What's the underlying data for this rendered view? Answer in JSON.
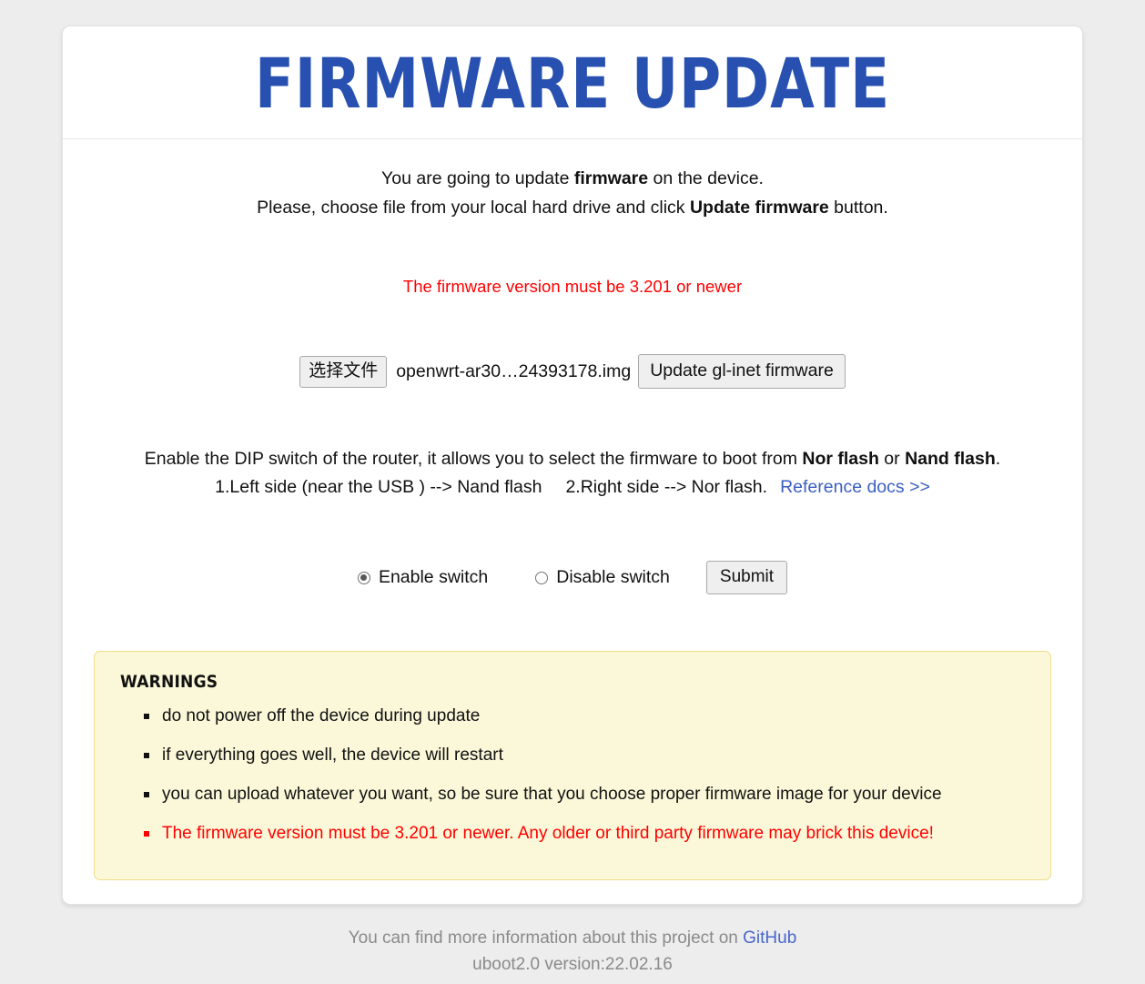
{
  "header": {
    "title": "FIRMWARE UPDATE"
  },
  "intro": {
    "line1_part1": "You are going to update ",
    "line1_bold": "firmware",
    "line1_part2": " on the device.",
    "line2_part1": "Please, choose file from your local hard drive and click ",
    "line2_bold": "Update firmware",
    "line2_part2": " button."
  },
  "notice": {
    "red_note": "The firmware version must be 3.201 or newer"
  },
  "upload": {
    "choose_file_label": "选择文件",
    "file_name": "openwrt-ar30…24393178.img",
    "update_button_label": "Update gl-inet firmware"
  },
  "dip": {
    "line1_part1": "Enable the DIP switch of the router, it allows you to select the firmware to boot from ",
    "line1_bold1": "Nor flash",
    "line1_mid": " or ",
    "line1_bold2": "Nand flash",
    "line1_end": ".",
    "line2_item1": "1.Left side (near the USB ) --> Nand flash",
    "line2_item2": "2.Right side --> Nor flash.",
    "docs_link_label": "Reference docs >>"
  },
  "switch": {
    "enable_label": "Enable switch",
    "disable_label": "Disable switch",
    "selected": "enable",
    "submit_label": "Submit"
  },
  "warnings": {
    "heading": "WARNINGS",
    "items": [
      {
        "text": "do not power off the device during update",
        "danger": false
      },
      {
        "text": "if everything goes well, the device will restart",
        "danger": false
      },
      {
        "text": "you can upload whatever you want, so be sure that you choose proper firmware image for your device",
        "danger": false
      },
      {
        "text": "The firmware version must be 3.201 or newer. Any older or third party firmware may brick this device!",
        "danger": true
      }
    ]
  },
  "footer": {
    "text_before_link": "You can find more information about this project on ",
    "link_label": "GitHub",
    "version": "uboot2.0 version:22.02.16"
  },
  "colors": {
    "title_blue": "#2750b0",
    "link_blue": "#3b5fc0",
    "footer_link_blue": "#4766cc",
    "danger_red": "#ff0000",
    "warning_bg": "#fbf8d9",
    "warning_border": "#f0dd8a",
    "page_bg": "#ededed"
  }
}
